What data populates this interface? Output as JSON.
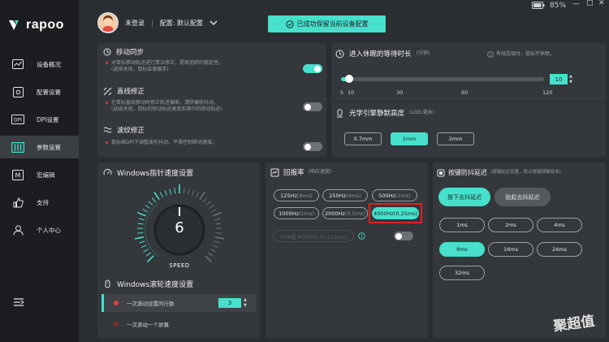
{
  "app": {
    "brand": "rapoo",
    "battery": "85%",
    "controls": [
      "minimize-icon",
      "maximize-icon",
      "close-icon"
    ]
  },
  "header": {
    "user": "未登录",
    "config": "配置: 默认配置",
    "save_notice": "已成功保留当前设备配置"
  },
  "sidebar": {
    "items": [
      {
        "label": "设备概况",
        "icon": "chart-icon"
      },
      {
        "label": "配置设置",
        "icon": "settings-icon"
      },
      {
        "label": "DPI设置",
        "icon": "dpi-icon"
      },
      {
        "label": "参数设置",
        "icon": "sliders-icon",
        "active": true
      },
      {
        "label": "宏编辑",
        "icon": "macro-icon"
      },
      {
        "label": "支持",
        "icon": "thumb-up-icon"
      },
      {
        "label": "个人中心",
        "icon": "user-icon"
      }
    ],
    "collapse_icon": "collapse-icon"
  },
  "mobile_sync": {
    "title": "移动同步",
    "desc1": "对鼠标移动轨迹进行算法修正，提高追踪的稳定性。",
    "desc2": "(选择关闭，鼠标会更跟手)",
    "enabled": true
  },
  "straight": {
    "title": "直线修正",
    "desc1": "在鼠标直线移动时修正轨迹偏差，清除偏移抖动。",
    "desc2": "(选择关闭，鼠标的移动轨迹更真实操作的移动轨迹)",
    "enabled": false
  },
  "ripple": {
    "title": "波纹修正",
    "desc1": "鼠标高DPI下调整波形抖动，平滑控制移动速度。",
    "enabled": false
  },
  "sleep": {
    "title": "进入休眠的等待时长",
    "unit": "(分钟)",
    "note": "有线连接时，鼠标不休眠。",
    "value": "10",
    "ticks": [
      "5",
      "10",
      "30",
      "60",
      "120"
    ],
    "fill_fraction": 0.04
  },
  "lod": {
    "title": "光学引擎静默高度",
    "unit": "(LOD,毫米)",
    "options": [
      "0.7mm",
      "1mm",
      "2mm"
    ],
    "selected": 1
  },
  "pointer_speed": {
    "title": "Windows指针速度设置",
    "value": "6",
    "label": "SPEED",
    "level_fraction": 0.5
  },
  "scroll_speed": {
    "title": "Windows滚轮速度设置",
    "row1": "一次滚动设置的行数",
    "row1_value": "3",
    "row2": "一次滚动一个屏幕"
  },
  "polling": {
    "title": "回报率",
    "unit": "(响应速度)",
    "options": [
      {
        "hz": "125Hz",
        "ms": "(8ms)"
      },
      {
        "hz": "250Hz",
        "ms": "(4ms)"
      },
      {
        "hz": "500Hz",
        "ms": "(2ms)"
      },
      {
        "hz": "1000Hz",
        "ms": "(1ms)"
      },
      {
        "hz": "2000Hz",
        "ms": "(0.5ms)"
      },
      {
        "hz": "4000Hz",
        "ms": "(0.25ms)"
      }
    ],
    "selected": 5,
    "ota": "OTA型 8000Hz (0.125ms)",
    "ota_enabled": false
  },
  "debounce": {
    "title": "按键防抖延迟",
    "unit": "(按键延迟设置，防止按键误触双击)",
    "press": "按下去抖延迟",
    "release": "抬起去抖延迟",
    "options": [
      "1ms",
      "2ms",
      "4ms",
      "8ms",
      "16ms",
      "24ms",
      "32ms"
    ],
    "selected": 3
  },
  "watermark": "聚超值",
  "colors": {
    "accent": "#46e0cc",
    "highlight_box": "#e02020",
    "sidebar": "#1b1d20",
    "panel": "#34373b"
  }
}
